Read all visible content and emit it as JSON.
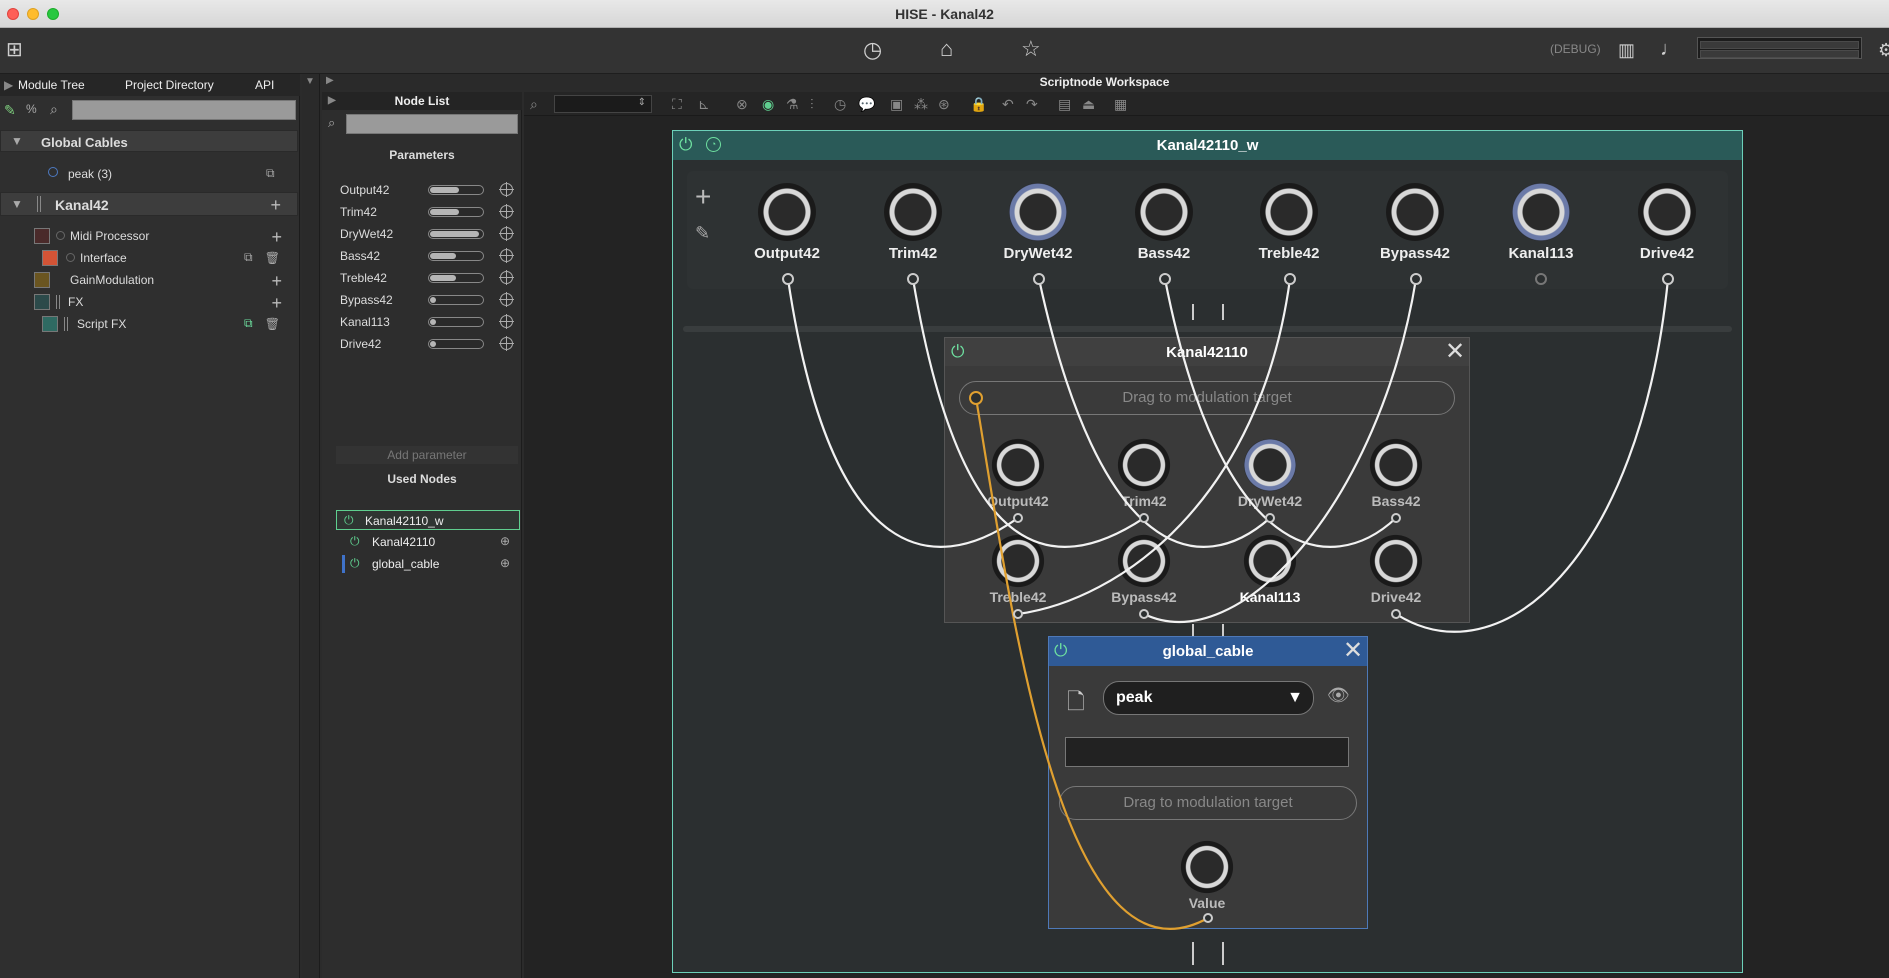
{
  "window": {
    "title": "HISE - Kanal42"
  },
  "toolbar": {
    "debug_label": "(DEBUG)"
  },
  "left_panel": {
    "tabs": [
      "Module Tree",
      "Project Directory",
      "API"
    ],
    "global_cables_label": "Global Cables",
    "cable_item": "peak (3)",
    "root_module": "Kanal42",
    "modules": [
      {
        "name": "Midi Processor"
      },
      {
        "name": "Interface"
      },
      {
        "name": "GainModulation"
      },
      {
        "name": "FX"
      },
      {
        "name": "Script FX"
      }
    ],
    "colors": {
      "midi": "#4a2a2a",
      "interface": "#d35436",
      "gain": "#6a5520",
      "fx": "#2c4a4a",
      "scriptfx": "#2f6a62"
    }
  },
  "workspace": {
    "title": "Scriptnode Workspace"
  },
  "node_list": {
    "header": "Node List",
    "parameters_label": "Parameters",
    "parameters": [
      {
        "name": "Output42",
        "value": 0.55
      },
      {
        "name": "Trim42",
        "value": 0.55
      },
      {
        "name": "DryWet42",
        "value": 0.95
      },
      {
        "name": "Bass42",
        "value": 0.5
      },
      {
        "name": "Treble42",
        "value": 0.5
      },
      {
        "name": "Bypass42",
        "value": 0.05
      },
      {
        "name": "Kanal113",
        "value": 0.05
      },
      {
        "name": "Drive42",
        "value": 0.05
      }
    ],
    "add_parameter": "Add parameter",
    "used_nodes_label": "Used Nodes",
    "used_nodes": [
      "Kanal42110_w",
      "Kanal42110",
      "global_cable"
    ]
  },
  "outer_node": {
    "title": "Kanal42110_w",
    "macros": [
      "Output42",
      "Trim42",
      "DryWet42",
      "Bass42",
      "Treble42",
      "Bypass42",
      "Kanal113",
      "Drive42"
    ]
  },
  "inner_node": {
    "title": "Kanal42110",
    "drag_label": "Drag to modulation target",
    "knobs_row1": [
      "Output42",
      "Trim42",
      "DryWet42",
      "Bass42"
    ],
    "knobs_row2": [
      "Treble42",
      "Bypass42",
      "Kanal113",
      "Drive42"
    ]
  },
  "global_cable_node": {
    "title": "global_cable",
    "selected_cable": "peak",
    "drag_label": "Drag to modulation target",
    "value_label": "Value"
  },
  "colors": {
    "accent_green": "#6cd0b9",
    "cable_orange": "#e0a030",
    "node_blue": "#2f5a96"
  }
}
